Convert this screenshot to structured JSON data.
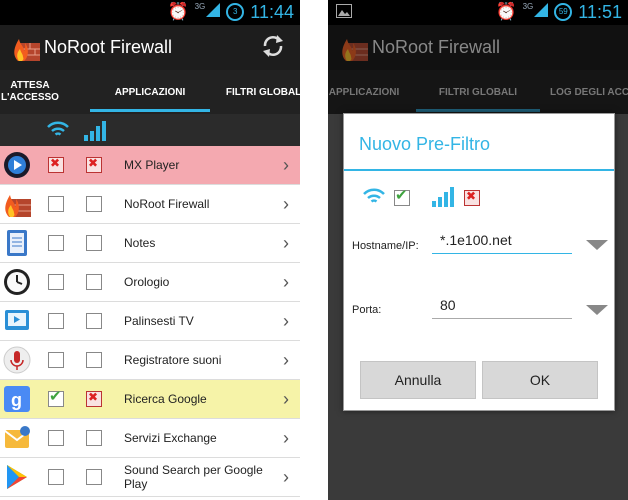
{
  "status_bar": {
    "left_time": "11:44",
    "right_time": "11:51",
    "network": "3G",
    "badge_left": "3",
    "badge_right": "59"
  },
  "app": {
    "title": "NoRoot Firewall"
  },
  "left_screen": {
    "tabs": [
      {
        "label": "ATTESA\nL'ACCESSO",
        "active": false
      },
      {
        "label": "APPLICAZIONI",
        "active": true
      },
      {
        "label": "FILTRI GLOBALI",
        "active": false
      }
    ],
    "apps": [
      {
        "name": "MX Player",
        "wifi": "x",
        "mobile": "x",
        "highlight": "red",
        "icon": "mx-player-icon"
      },
      {
        "name": "NoRoot Firewall",
        "wifi": "",
        "mobile": "",
        "highlight": "",
        "icon": "firewall-icon"
      },
      {
        "name": "Notes",
        "wifi": "",
        "mobile": "",
        "highlight": "",
        "icon": "notes-icon"
      },
      {
        "name": "Orologio",
        "wifi": "",
        "mobile": "",
        "highlight": "",
        "icon": "clock-icon"
      },
      {
        "name": "Palinsesti TV",
        "wifi": "",
        "mobile": "",
        "highlight": "",
        "icon": "tv-guide-icon"
      },
      {
        "name": "Registratore suoni",
        "wifi": "",
        "mobile": "",
        "highlight": "",
        "icon": "microphone-icon"
      },
      {
        "name": "Ricerca Google",
        "wifi": "check",
        "mobile": "x",
        "highlight": "yellow",
        "icon": "google-icon"
      },
      {
        "name": "Servizi Exchange",
        "wifi": "",
        "mobile": "",
        "highlight": "",
        "icon": "exchange-icon"
      },
      {
        "name": "Sound Search per Google Play",
        "wifi": "",
        "mobile": "",
        "highlight": "",
        "icon": "play-store-icon"
      }
    ]
  },
  "right_screen": {
    "tabs": [
      {
        "label": "APPLICAZIONI",
        "active": false
      },
      {
        "label": "FILTRI GLOBALI",
        "active": true
      },
      {
        "label": "LOG DEGLI ACCE",
        "active": false
      }
    ],
    "dialog": {
      "title": "Nuovo Pre-Filtro",
      "hostname_label": "Hostname/IP:",
      "hostname_value": "*.1e100.net",
      "port_label": "Porta:",
      "port_value": "80",
      "cancel_label": "Annulla",
      "ok_label": "OK"
    }
  },
  "colors": {
    "accent": "#33b5e5",
    "blocked_row": "#f4a9b0",
    "allowed_row": "#f6f3a8"
  }
}
